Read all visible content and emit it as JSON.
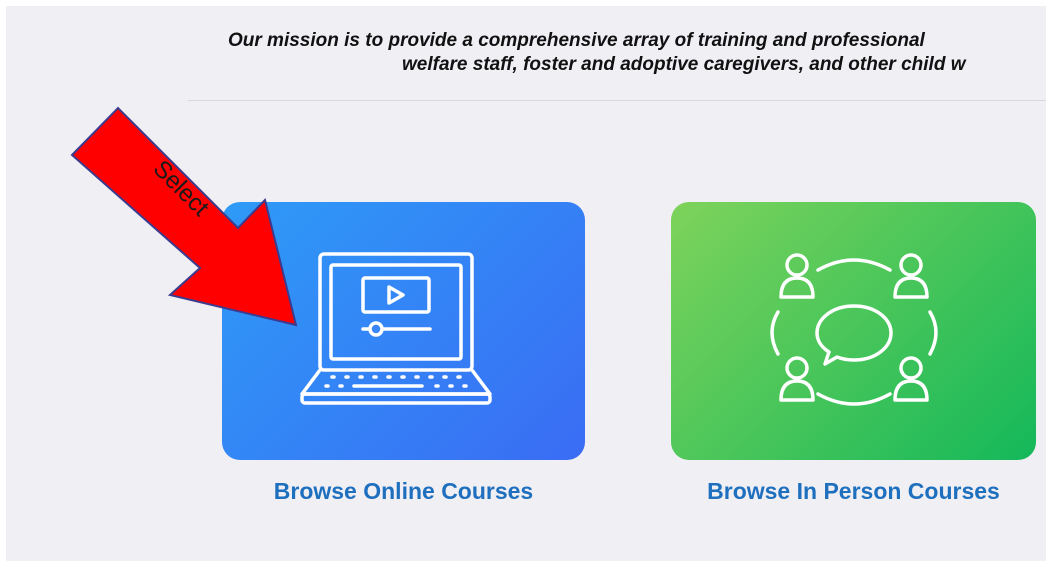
{
  "mission": {
    "line1": "Our mission is to provide a comprehensive array of training and professional",
    "line2": "welfare staff, foster and adoptive caregivers, and other child w"
  },
  "annotation": {
    "text": "Select",
    "color": "#ff0000"
  },
  "cards": {
    "online": {
      "label": "Browse Online Courses",
      "icon": "laptop-video-icon",
      "gradient": [
        "#2e9bf7",
        "#3a6cf4"
      ]
    },
    "inperson": {
      "label": "Browse In Person Courses",
      "icon": "group-chat-icon",
      "gradient": [
        "#7ed35b",
        "#14b85a"
      ]
    }
  },
  "colors": {
    "background": "#efeff4",
    "link": "#1f6fbf"
  }
}
